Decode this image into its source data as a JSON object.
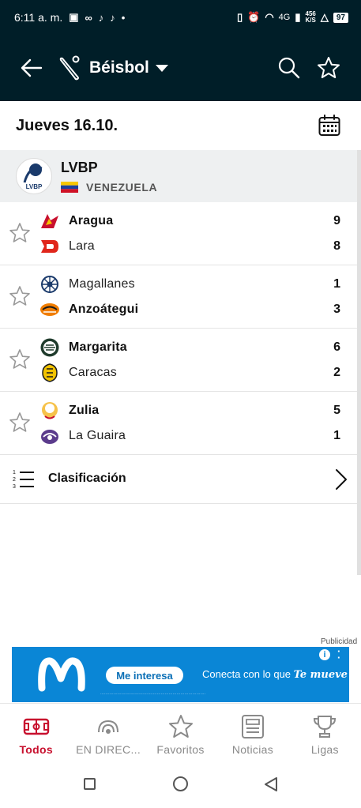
{
  "status_bar": {
    "time": "6:11 a. m.",
    "network": "4G",
    "speed_top": "456",
    "speed_unit": "K/S",
    "battery": "97"
  },
  "header": {
    "title": "Béisbol"
  },
  "date_label": "Jueves 16.10.",
  "league": {
    "name": "LVBP",
    "country": "VENEZUELA",
    "logo_text": "LVBP"
  },
  "matches": [
    {
      "home": {
        "name": "Aragua",
        "score": "9",
        "winner": true
      },
      "away": {
        "name": "Lara",
        "score": "8",
        "winner": false
      }
    },
    {
      "home": {
        "name": "Magallanes",
        "score": "1",
        "winner": false
      },
      "away": {
        "name": "Anzoátegui",
        "score": "3",
        "winner": true
      }
    },
    {
      "home": {
        "name": "Margarita",
        "score": "6",
        "winner": true
      },
      "away": {
        "name": "Caracas",
        "score": "2",
        "winner": false
      }
    },
    {
      "home": {
        "name": "Zulia",
        "score": "5",
        "winner": true
      },
      "away": {
        "name": "La Guaira",
        "score": "1",
        "winner": false
      }
    }
  ],
  "standings_label": "Clasificación",
  "ad": {
    "label": "Publicidad",
    "cta": "Me interesa",
    "tagline": "Conecta con lo que",
    "tagline_em": "Te mueve"
  },
  "bottom_nav": [
    {
      "label": "Todos",
      "icon": "soccer-field-icon",
      "active": true
    },
    {
      "label": "EN DIREC...",
      "icon": "live-broadcast-icon",
      "active": false
    },
    {
      "label": "Favoritos",
      "icon": "star-icon",
      "active": false
    },
    {
      "label": "Noticias",
      "icon": "newspaper-icon",
      "active": false
    },
    {
      "label": "Ligas",
      "icon": "trophy-icon",
      "active": false
    }
  ],
  "colors": {
    "header_bg": "#001e28",
    "accent": "#c8102e",
    "league_bg": "#eef0f1",
    "ad_bg": "#0a86d6"
  }
}
